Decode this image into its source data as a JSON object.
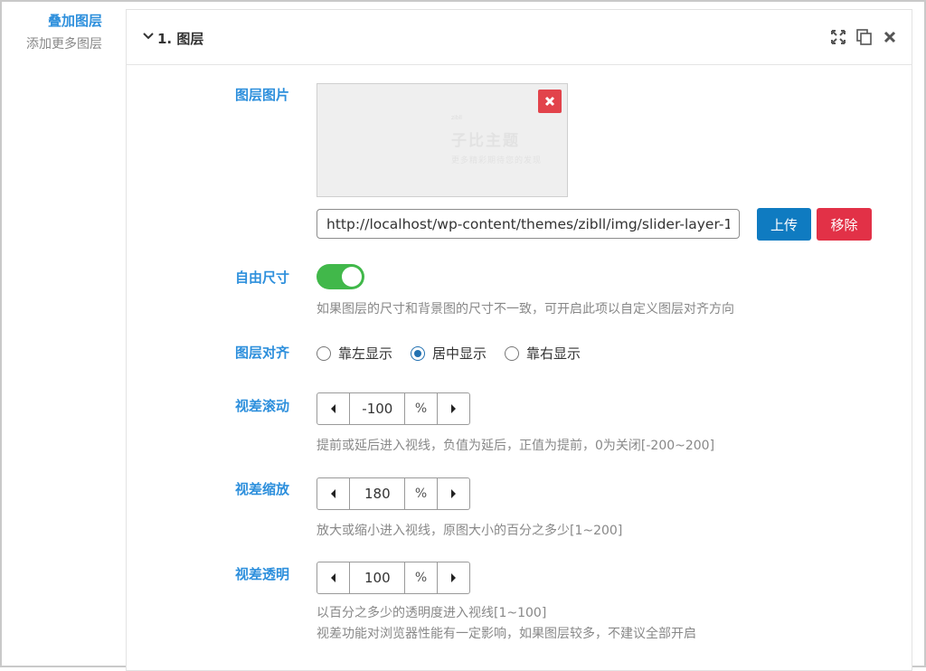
{
  "section": {
    "title": "叠加图层",
    "subtitle": "添加更多图层"
  },
  "panel": {
    "title": "1. 图层",
    "icons": [
      "expand-icon",
      "copy-icon",
      "close-icon"
    ]
  },
  "image_field": {
    "label": "图层图片",
    "watermark_main": "子比主题",
    "watermark_sub": "更多精彩期待您的发现",
    "watermark_tiny": "zibll",
    "url": "http://localhost/wp-content/themes/zibll/img/slider-layer-1.png",
    "upload_label": "上传",
    "remove_label": "移除"
  },
  "free_size": {
    "label": "自由尺寸",
    "enabled": true,
    "description": "如果图层的尺寸和背景图的尺寸不一致，可开启此项以自定义图层对齐方向"
  },
  "align": {
    "label": "图层对齐",
    "options": [
      "靠左显示",
      "居中显示",
      "靠右显示"
    ],
    "selected": "居中显示"
  },
  "parallax_scroll": {
    "label": "视差滚动",
    "value": "-100",
    "unit": "%",
    "description": "提前或延后进入视线，负值为延后，正值为提前，0为关闭[-200~200]"
  },
  "parallax_scale": {
    "label": "视差缩放",
    "value": "180",
    "unit": "%",
    "description": "放大或缩小进入视线，原图大小的百分之多少[1~200]"
  },
  "parallax_opacity": {
    "label": "视差透明",
    "value": "100",
    "unit": "%",
    "description": "以百分之多少的透明度进入视线[1~100]",
    "note": "视差功能对浏览器性能有一定影响，如果图层较多，不建议全部开启"
  },
  "colors": {
    "label_blue": "#2d8fdc",
    "upload_blue": "#0f7bc1",
    "remove_red": "#e23147",
    "toggle_green": "#41b84a",
    "delete_red": "#e2434b"
  }
}
